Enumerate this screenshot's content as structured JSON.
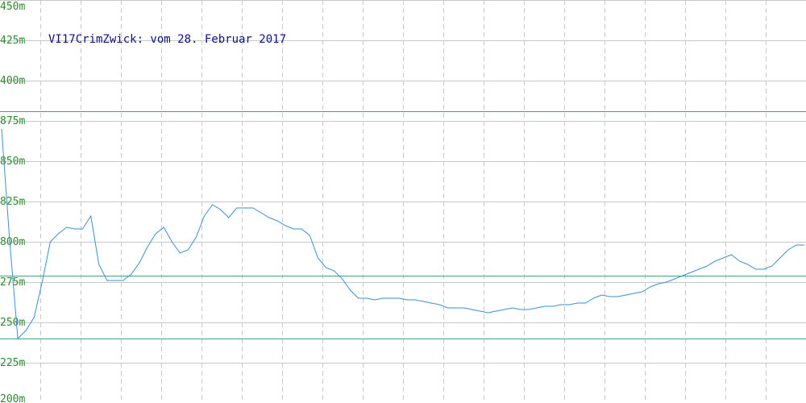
{
  "chart_data": {
    "type": "line",
    "title": "VI17CrimZwick: vom 28. Februar 2017",
    "xlabel": "",
    "ylabel": "",
    "y_tick_labels": [
      "450m",
      "425m",
      "400m",
      "875m",
      "850m",
      "825m",
      "800m",
      "275m",
      "250m",
      "225m",
      "200m"
    ],
    "ylim": [
      200,
      450
    ],
    "x_grid_count": 20,
    "reference_lines": [
      381,
      279,
      240
    ],
    "grid": true,
    "colors": {
      "series": "#3a8fd8",
      "reference": "#3aa87a",
      "grid": "#c8c8c8",
      "ticks": "#2e8b2e",
      "title": "#101080"
    },
    "series": [
      {
        "x": [
          0,
          1,
          2,
          3,
          4,
          5,
          6,
          7,
          8,
          9,
          10,
          11,
          12,
          13,
          14,
          15,
          16,
          17,
          18,
          19,
          20,
          21,
          22,
          23,
          24,
          25,
          26,
          27,
          28,
          29,
          30,
          31,
          32,
          33,
          34,
          35,
          36,
          37,
          38,
          39,
          40,
          41,
          42,
          43,
          44,
          45,
          46,
          47,
          48,
          49,
          50,
          51,
          52,
          53,
          54,
          55,
          56,
          57,
          58,
          59,
          60,
          61,
          62,
          63,
          64,
          65,
          66,
          67,
          68,
          69,
          70,
          71,
          72,
          73,
          74,
          75,
          76,
          77,
          78,
          79,
          80,
          81,
          82,
          83,
          84,
          85,
          86,
          87,
          88,
          89,
          90,
          91,
          92,
          93,
          94,
          95,
          96,
          97,
          98,
          99
        ],
        "y": [
          370,
          300,
          240,
          245,
          253,
          275,
          300,
          305,
          309,
          308,
          308,
          316,
          286,
          276,
          276,
          276,
          280,
          287,
          297,
          305,
          309,
          300,
          293,
          295,
          303,
          316,
          323,
          320,
          315,
          321,
          321,
          321,
          318,
          315,
          313,
          310,
          308,
          308,
          304,
          290,
          284,
          282,
          277,
          270,
          265,
          265,
          264,
          265,
          265,
          265,
          264,
          264,
          263,
          262,
          261,
          259,
          259,
          259,
          258,
          257,
          256,
          257,
          258,
          259,
          258,
          258,
          259,
          260,
          260,
          261,
          261,
          262,
          262,
          265,
          267,
          266,
          266,
          267,
          268,
          269,
          272,
          274,
          275,
          277,
          279,
          281,
          283,
          285,
          288,
          290,
          292,
          288,
          286,
          283,
          283,
          285,
          290,
          295,
          298,
          298
        ]
      }
    ]
  }
}
